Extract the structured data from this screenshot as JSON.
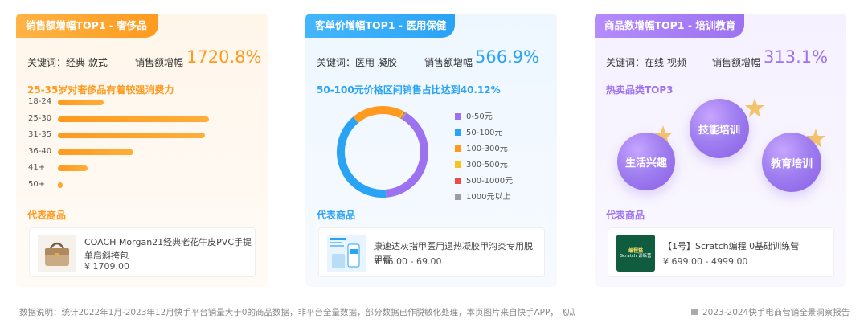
{
  "card1": {
    "tag": "销售额增幅TOP1 - 奢侈品",
    "keywords": "关键词：经典  款式",
    "sales_label": "销售额增幅",
    "sales_value": "1720.8%",
    "subtitle": "25-35岁对奢侈品有着较强消费力",
    "rep_title": "代表商品",
    "product_name": "COACH Morgan21经典老花牛皮PVC手提单肩斜挎包",
    "product_price": "¥ 1709.00"
  },
  "card2": {
    "tag": "客单价增幅TOP1 - 医用保健",
    "keywords": "关键词：医用  凝胶",
    "sales_label": "销售额增幅",
    "sales_value": "566.9%",
    "subtitle": "50-100元价格区间销售占比达到40.12%",
    "rep_title": "代表商品",
    "product_name": "康速达灰指甲医用退热凝胶甲沟炎专用脱甲膏",
    "product_price": "¥ 56.00 - 69.00"
  },
  "card3": {
    "tag": "商品数增幅TOP1 - 培训教育",
    "keywords": "关键词：在线  视频",
    "sales_label": "销售额增幅",
    "sales_value": "313.1%",
    "subtitle": "热卖品类TOP3",
    "rep_title": "代表商品",
    "product_name": "【1号】Scratch编程 0基础训练营",
    "product_price": "¥ 699.00 - 4999.00",
    "top3": [
      "生活兴趣",
      "技能培训",
      "教育培训"
    ],
    "thumb_text": [
      "编程猫",
      "Scratch 训练营"
    ]
  },
  "colors": {
    "orange": "#ff9a1f",
    "blue": "#2aa3f5",
    "purple": "#9c72f0"
  },
  "chart_data": [
    {
      "type": "bar",
      "orientation": "horizontal",
      "categories": [
        "18-24",
        "25-30",
        "31-35",
        "36-40",
        "41+",
        "50+"
      ],
      "values": [
        11,
        36,
        35,
        18,
        7,
        1
      ],
      "color": "#ff9a1f"
    },
    {
      "type": "pie",
      "style": "donut",
      "labels": [
        "0-50元",
        "50-100元",
        "100-300元",
        "300-500元",
        "500-1000元",
        "1000元以上"
      ],
      "values": [
        40.0,
        40.12,
        18.5,
        0.5,
        0.3,
        0.58
      ],
      "colors": [
        "#9c72f0",
        "#2aa3f5",
        "#ff9a1f",
        "#f5c518",
        "#e84b4b",
        "#9e9e9e"
      ]
    }
  ],
  "footer": {
    "note": "数据说明：统计2022年1月-2023年12月快手平台销量大于0的商品数据，非平台全量数据，部分数据已作脱敏化处理，本页图片来自快手APP，飞瓜",
    "report": "2023-2024快手电商营销全景洞察报告"
  }
}
